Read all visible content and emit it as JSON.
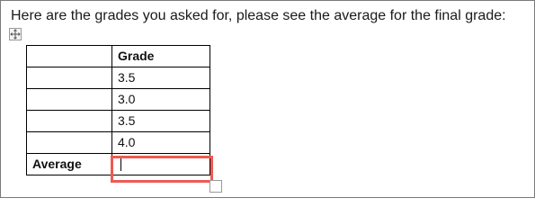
{
  "document": {
    "intro_text": "Here are the grades you asked for, please see the average for the final grade:"
  },
  "icons": {
    "table_move_handle": "four-way-arrow-move-icon",
    "table_resize_handle": "resize-square-icon"
  },
  "table": {
    "header": [
      "",
      "Grade"
    ],
    "rows": [
      {
        "label": "",
        "grade": "3.5"
      },
      {
        "label": "",
        "grade": "3.0"
      },
      {
        "label": "",
        "grade": "3.5"
      },
      {
        "label": "",
        "grade": "4.0"
      }
    ],
    "average_row": {
      "label": "Average",
      "value": ""
    }
  },
  "colors": {
    "highlight": "#ee5a52"
  }
}
